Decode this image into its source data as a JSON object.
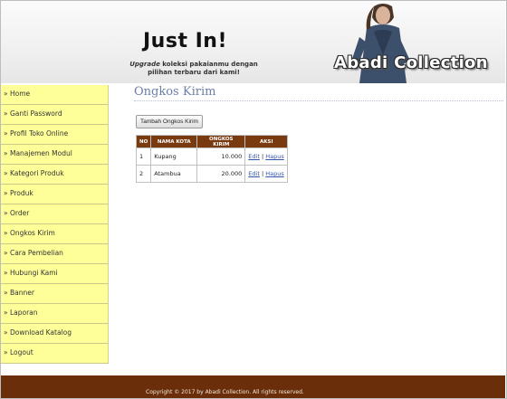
{
  "header": {
    "title": "Just In!",
    "subtitle_italic": "Upgrade",
    "subtitle_rest_1": " koleksi pakaianmu dengan",
    "subtitle_rest_2": "pilihan terbaru dari kami!",
    "brand": "Abadi Collection"
  },
  "sidebar": {
    "items": [
      {
        "label": "» Home"
      },
      {
        "label": "» Ganti Password"
      },
      {
        "label": "» Profil Toko Online"
      },
      {
        "label": "» Manajemen Modul"
      },
      {
        "label": "» Kategori Produk"
      },
      {
        "label": "» Produk"
      },
      {
        "label": "» Order"
      },
      {
        "label": "» Ongkos Kirim"
      },
      {
        "label": "» Cara Pembelian"
      },
      {
        "label": "» Hubungi Kami"
      },
      {
        "label": "» Banner"
      },
      {
        "label": "» Laporan"
      },
      {
        "label": "» Download Katalog"
      },
      {
        "label": "» Logout"
      }
    ]
  },
  "main": {
    "title": "Ongkos Kirim",
    "add_button": "Tambah Ongkos Kirim",
    "table": {
      "headers": [
        "NO",
        "NAMA KOTA",
        "ONGKOS KIRIM",
        "AKSI"
      ],
      "rows": [
        {
          "no": "1",
          "kota": "Kupang",
          "ongkos": "10.000",
          "edit": "Edit",
          "sep": " | ",
          "hapus": "Hapus"
        },
        {
          "no": "2",
          "kota": "Atambua",
          "ongkos": "20.000",
          "edit": "Edit",
          "sep": " | ",
          "hapus": "Hapus"
        }
      ]
    }
  },
  "footer": {
    "text": "Copyright © 2017 by Abadi Collection. All rights reserved."
  },
  "colors": {
    "menu_bg": "#ffff99",
    "table_header": "#7a3a10",
    "footer_bg": "#6a2f0a",
    "title": "#6b7ea6"
  }
}
